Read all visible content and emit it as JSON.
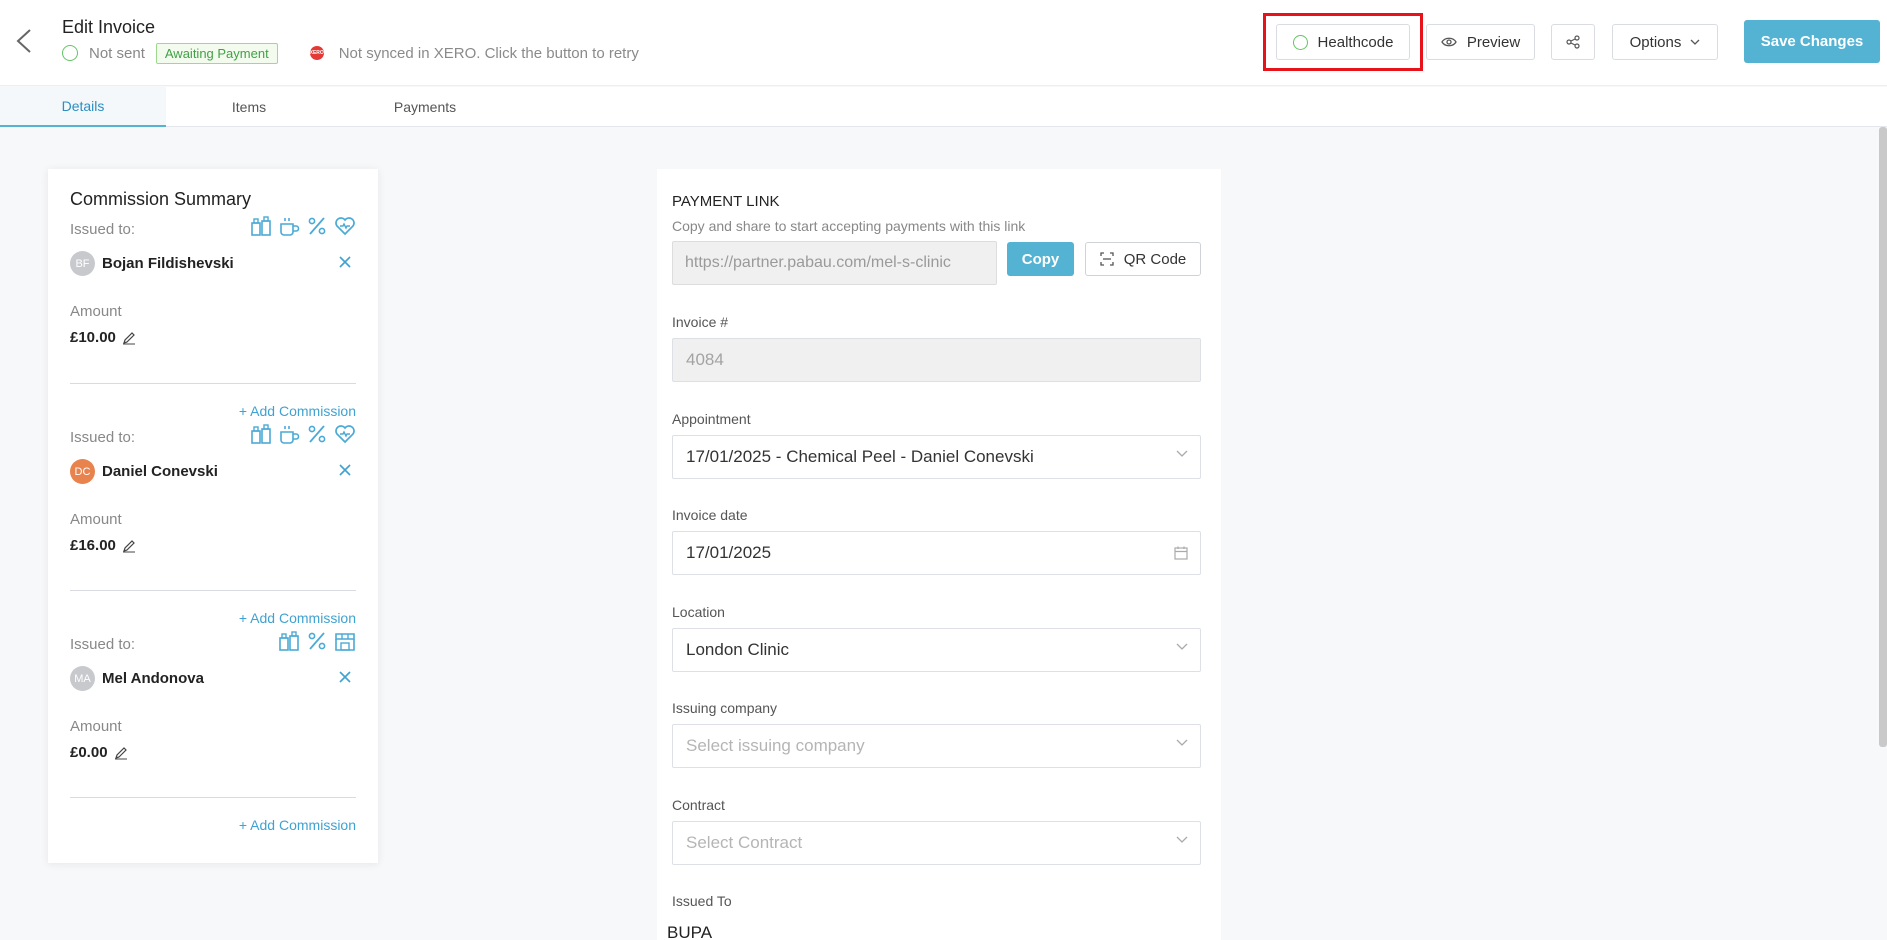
{
  "header": {
    "title": "Edit Invoice",
    "sent_status": "Not sent",
    "payment_badge": "Awaiting Payment",
    "xero_badge": "XERO",
    "xero_status": "Not synced in XERO. Click the button to retry",
    "healthcode_label": "Healthcode",
    "preview_label": "Preview",
    "options_label": "Options",
    "save_label": "Save Changes",
    "icons": {
      "back": "chevron-left-icon",
      "healthcode": "circle-icon",
      "preview": "eye-icon",
      "share": "share-icon",
      "options": "chevron-down-icon"
    },
    "colors": {
      "accent": "#54b2d3",
      "highlight": "#e8131a",
      "success": "#65c466",
      "error": "#e53935"
    }
  },
  "tabs": [
    {
      "label": "Details",
      "active": true
    },
    {
      "label": "Items",
      "active": false
    },
    {
      "label": "Payments",
      "active": false
    }
  ],
  "commission": {
    "title": "Commission Summary",
    "issued_label": "Issued to:",
    "amount_label": "Amount",
    "add_label": "+ Add Commission",
    "entries": [
      {
        "initials": "BF",
        "name": "Bojan Fildishevski",
        "amount": "£10.00",
        "icons": [
          "products-icon",
          "cup-icon",
          "percent-icon",
          "heart-icon"
        ]
      },
      {
        "initials": "DC",
        "name": "Daniel Conevski",
        "amount": "£16.00",
        "icons": [
          "products-icon",
          "cup-icon",
          "percent-icon",
          "heart-icon"
        ]
      },
      {
        "initials": "MA",
        "name": "Mel Andonova",
        "amount": "£0.00",
        "icons": [
          "products-icon",
          "percent-icon",
          "store-icon"
        ]
      }
    ]
  },
  "details": {
    "payment_link_title": "PAYMENT LINK",
    "payment_link_subtitle": "Copy and share to start accepting payments with this link",
    "payment_link_value": "https://partner.pabau.com/mel-s-clinic",
    "copy_label": "Copy",
    "qr_label": "QR Code",
    "invoice_no_label": "Invoice #",
    "invoice_no_value": "4084",
    "appointment_label": "Appointment",
    "appointment_value": "17/01/2025 - Chemical Peel - Daniel Conevski",
    "invoice_date_label": "Invoice date",
    "invoice_date_value": "17/01/2025",
    "location_label": "Location",
    "location_value": "London Clinic",
    "issuing_company_label": "Issuing company",
    "issuing_company_placeholder": "Select issuing company",
    "contract_label": "Contract",
    "contract_placeholder": "Select Contract",
    "issued_to_label": "Issued To",
    "issued_to_value": "BUPA"
  }
}
